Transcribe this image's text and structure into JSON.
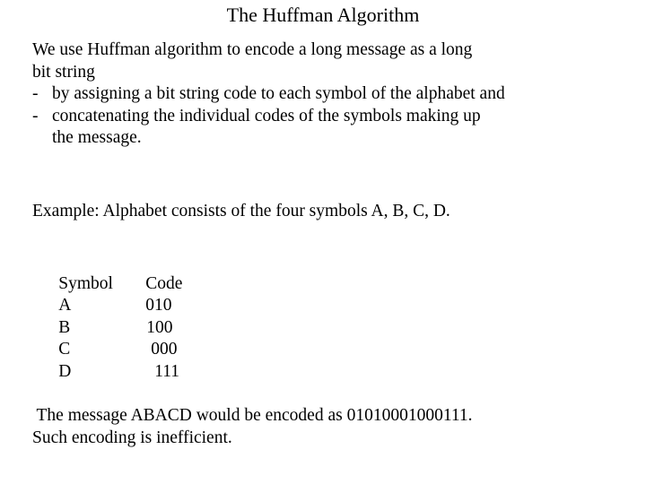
{
  "slide": {
    "title": "The Huffman Algorithm",
    "intro": {
      "line1": "We use Huffman algorithm to encode a long message as a long",
      "line2": "bit string",
      "bullets": [
        {
          "marker": "-",
          "text": "by assigning a bit string code to each symbol of the alphabet and"
        },
        {
          "marker": "-",
          "text": "concatenating the individual codes of the symbols making up",
          "continuation": "the message."
        }
      ]
    },
    "example": {
      "line": "Example: Alphabet consists of the four symbols A, B, C, D."
    },
    "code_table": {
      "headers": {
        "symbol": "Symbol",
        "code": "Code"
      },
      "rows": [
        {
          "symbol": "A",
          "code": "010",
          "code_indent": 0
        },
        {
          "symbol": "B",
          "code": "100",
          "code_indent": 1
        },
        {
          "symbol": "C",
          "code": "000",
          "code_indent": 6
        },
        {
          "symbol": "D",
          "code": "111",
          "code_indent": 10
        }
      ]
    },
    "closing": {
      "line1": " The message ABACD would be encoded as 01010001000111.",
      "line2": "Such encoding is inefficient."
    }
  },
  "colors": {
    "background": "#ffffff",
    "text": "#000000"
  }
}
